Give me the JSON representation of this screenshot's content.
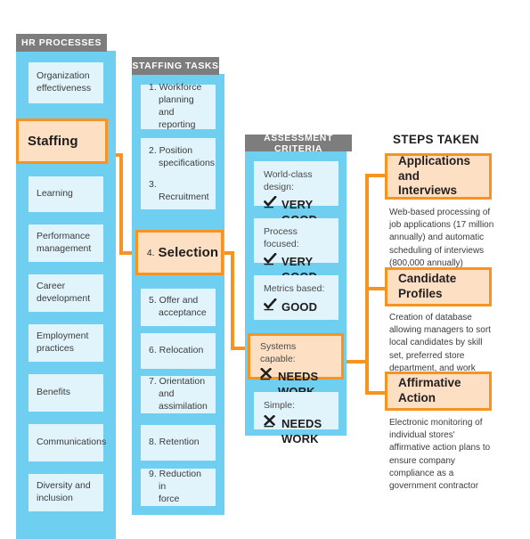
{
  "columns": {
    "hr": {
      "header": "HR PROCESSES",
      "items": [
        {
          "label": "Organization\neffectiveness",
          "highlight": false
        },
        {
          "label": "Staffing",
          "highlight": true
        },
        {
          "label": "Learning",
          "highlight": false
        },
        {
          "label": "Performance\nmanagement",
          "highlight": false
        },
        {
          "label": "Career\ndevelopment",
          "highlight": false
        },
        {
          "label": "Employment\npractices",
          "highlight": false
        },
        {
          "label": "Benefits",
          "highlight": false
        },
        {
          "label": "Communications",
          "highlight": false
        },
        {
          "label": "Diversity and\ninclusion",
          "highlight": false
        }
      ]
    },
    "tasks": {
      "header": "STAFFING TASKS",
      "items": [
        {
          "num": "1.",
          "label": "Workforce\nplanning\nand reporting",
          "highlight": false
        },
        {
          "num": "2.",
          "label": "Position\nspecifications",
          "highlight": false
        },
        {
          "num": "3.",
          "label": "Recruitment",
          "highlight": false
        },
        {
          "num": "4.",
          "label": "Selection",
          "highlight": true
        },
        {
          "num": "5.",
          "label": "Offer and\nacceptance",
          "highlight": false
        },
        {
          "num": "6.",
          "label": "Relocation",
          "highlight": false
        },
        {
          "num": "7.",
          "label": "Orientation and\nassimilation",
          "highlight": false
        },
        {
          "num": "8.",
          "label": "Retention",
          "highlight": false
        },
        {
          "num": "9.",
          "label": "Reduction in\nforce",
          "highlight": false
        }
      ]
    },
    "assessment": {
      "header": "ASSESSMENT CRITERIA",
      "items": [
        {
          "label": "World-class design:",
          "verdict": "VERY GOOD",
          "mark": "check-icon",
          "highlight": false
        },
        {
          "label": "Process focused:",
          "verdict": "VERY GOOD",
          "mark": "check-icon",
          "highlight": false
        },
        {
          "label": "Metrics based:",
          "verdict": "GOOD",
          "mark": "check-icon",
          "highlight": false
        },
        {
          "label": "Systems capable:",
          "verdict": "NEEDS WORK",
          "mark": "x-icon",
          "highlight": true
        },
        {
          "label": "Simple:",
          "verdict": "NEEDS WORK",
          "mark": "x-icon",
          "highlight": false
        }
      ]
    },
    "steps": {
      "header": "STEPS TAKEN",
      "items": [
        {
          "title": "Applications\nand Interviews",
          "description": "Web-based processing of job applications (17 million annually) and automatic scheduling of interviews (800,000 annually)"
        },
        {
          "title": "Candidate Profiles",
          "description": "Creation of database allowing managers to sort local candidates by skill set, preferred store department, and work history"
        },
        {
          "title": "Affirmative Action",
          "description": "Electronic monitoring of individual stores' affirmative action plans to ensure company compliance as a government contractor"
        }
      ]
    }
  },
  "colors": {
    "band": "#6ecff0",
    "node": "#e1f4fb",
    "header_bar": "#7d7d7d",
    "accent": "#f79421",
    "highlight_fill": "#fde0c3"
  }
}
